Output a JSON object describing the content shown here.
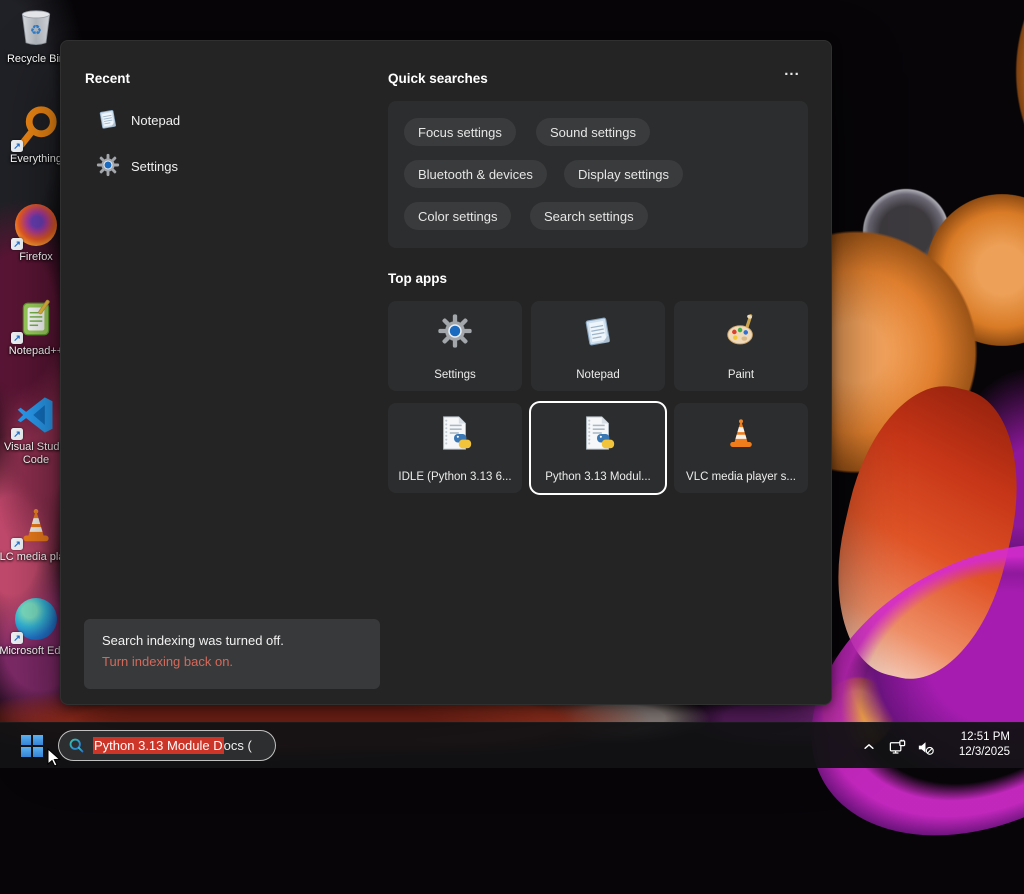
{
  "desktop": {
    "icons": [
      {
        "name": "recycle-bin",
        "label": "Recycle Bin"
      },
      {
        "name": "everything",
        "label": "Everything"
      },
      {
        "name": "firefox",
        "label": "Firefox"
      },
      {
        "name": "notepad-plus-plus",
        "label": "Notepad++"
      },
      {
        "name": "visual-studio-code",
        "label": "Visual Studio Code"
      },
      {
        "name": "vlc-media-player",
        "label": "VLC media player"
      },
      {
        "name": "microsoft-edge",
        "label": "Microsoft Edge"
      }
    ]
  },
  "search_panel": {
    "recent": {
      "title": "Recent",
      "items": [
        {
          "label": "Notepad",
          "icon": "notepad-icon"
        },
        {
          "label": "Settings",
          "icon": "gear-icon"
        }
      ]
    },
    "quick_searches": {
      "title": "Quick searches",
      "more_label": "...",
      "pills": [
        "Focus settings",
        "Sound settings",
        "Bluetooth & devices",
        "Display settings",
        "Color settings",
        "Search settings"
      ]
    },
    "top_apps": {
      "title": "Top apps",
      "tiles": [
        {
          "label": "Settings",
          "icon": "gear-icon",
          "selected": false
        },
        {
          "label": "Notepad",
          "icon": "notepad-icon",
          "selected": false
        },
        {
          "label": "Paint",
          "icon": "paint-icon",
          "selected": false
        },
        {
          "label": "IDLE (Python 3.13 6...",
          "icon": "python-doc-icon",
          "selected": false
        },
        {
          "label": "Python 3.13 Modul...",
          "icon": "python-doc-icon",
          "selected": true
        },
        {
          "label": "VLC media player s...",
          "icon": "vlc-icon",
          "selected": false
        }
      ]
    },
    "notice": {
      "message": "Search indexing was turned off.",
      "action": "Turn indexing back on."
    }
  },
  "taskbar": {
    "search": {
      "selected_text": "Python 3.13 Module D",
      "rest_text": "ocs ("
    },
    "tray": {
      "time": "12:51 PM",
      "date": "12/3/2025"
    }
  },
  "colors": {
    "selection_red": "#cc3528",
    "link_red": "#d4695a",
    "accent_blue": "#1a6bc0"
  }
}
